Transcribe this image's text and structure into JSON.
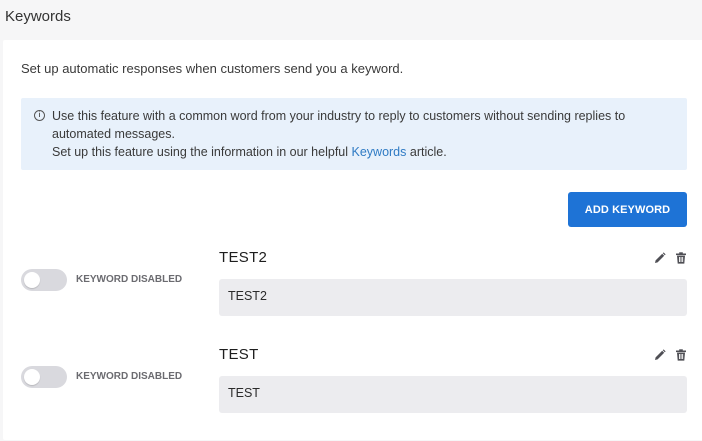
{
  "page": {
    "title": "Keywords"
  },
  "intro": "Set up automatic responses when customers send you a keyword.",
  "info": {
    "icon": "info-circle-icon",
    "line1": "Use this feature with a common word from your industry to reply to customers without sending replies to automated messages.",
    "line2_prefix": "Set up this feature using the information in our helpful ",
    "link_text": "Keywords",
    "line2_suffix": " article."
  },
  "add_button": {
    "label": "ADD KEYWORD"
  },
  "keywords": [
    {
      "status_label": "KEYWORD DISABLED",
      "enabled": false,
      "name": "TEST2",
      "value": "TEST2"
    },
    {
      "status_label": "KEYWORD DISABLED",
      "enabled": false,
      "name": "TEST",
      "value": "TEST"
    }
  ],
  "colors": {
    "accent": "#1e73d6",
    "info_bg": "#e8f1fb",
    "link": "#2f7bc4"
  }
}
